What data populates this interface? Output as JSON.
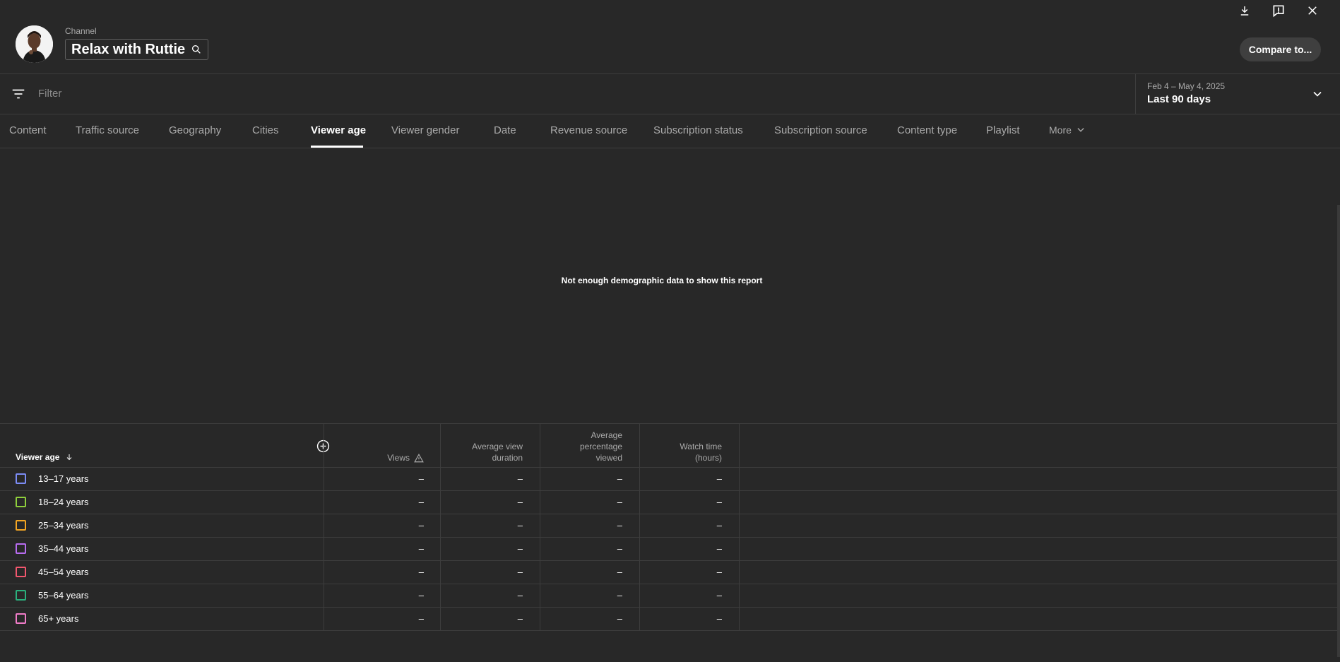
{
  "header": {
    "channel_caption": "Channel",
    "channel_name": "Relax with Ruttie",
    "compare_label": "Compare to..."
  },
  "filter": {
    "placeholder": "Filter"
  },
  "date_range": {
    "range": "Feb 4 – May 4, 2025",
    "label": "Last 90 days"
  },
  "tabs": [
    {
      "label": "Content"
    },
    {
      "label": "Traffic source"
    },
    {
      "label": "Geography"
    },
    {
      "label": "Cities"
    },
    {
      "label": "Viewer age"
    },
    {
      "label": "Viewer gender"
    },
    {
      "label": "Date"
    },
    {
      "label": "Revenue source"
    },
    {
      "label": "Subscription status"
    },
    {
      "label": "Subscription source"
    },
    {
      "label": "Content type"
    },
    {
      "label": "Playlist"
    }
  ],
  "more_tab": "More",
  "active_tab": "Viewer age",
  "chart_message": "Not enough demographic data to show this report",
  "table": {
    "dimension_header": "Viewer age",
    "columns": [
      {
        "line1": "",
        "line2": "",
        "line3": "Views"
      },
      {
        "line1": "",
        "line2": "Average view",
        "line3": "duration"
      },
      {
        "line1": "Average",
        "line2": "percentage",
        "line3": "viewed"
      },
      {
        "line1": "",
        "line2": "Watch time",
        "line3": "(hours)"
      }
    ],
    "rows": [
      {
        "label": "13–17 years",
        "color": "#7c8cf5",
        "values": [
          "–",
          "–",
          "–",
          "–"
        ]
      },
      {
        "label": "18–24 years",
        "color": "#8fcf3c",
        "values": [
          "–",
          "–",
          "–",
          "–"
        ]
      },
      {
        "label": "25–34 years",
        "color": "#f5a623",
        "values": [
          "–",
          "–",
          "–",
          "–"
        ]
      },
      {
        "label": "35–44 years",
        "color": "#b86cf0",
        "values": [
          "–",
          "–",
          "–",
          "–"
        ]
      },
      {
        "label": "45–54 years",
        "color": "#f2576e",
        "values": [
          "–",
          "–",
          "–",
          "–"
        ]
      },
      {
        "label": "55–64 years",
        "color": "#2bb07d",
        "values": [
          "–",
          "–",
          "–",
          "–"
        ]
      },
      {
        "label": "65+ years",
        "color": "#f07cc8",
        "values": [
          "–",
          "–",
          "–",
          "–"
        ]
      }
    ]
  },
  "icons": {
    "download": "download-icon",
    "feedback": "feedback-icon",
    "close": "close-icon",
    "search": "search-icon",
    "filter": "filter-icon",
    "chevron": "chevron-down-icon",
    "sort": "arrow-down-icon",
    "add": "add-column-icon",
    "warning": "warning-icon"
  }
}
